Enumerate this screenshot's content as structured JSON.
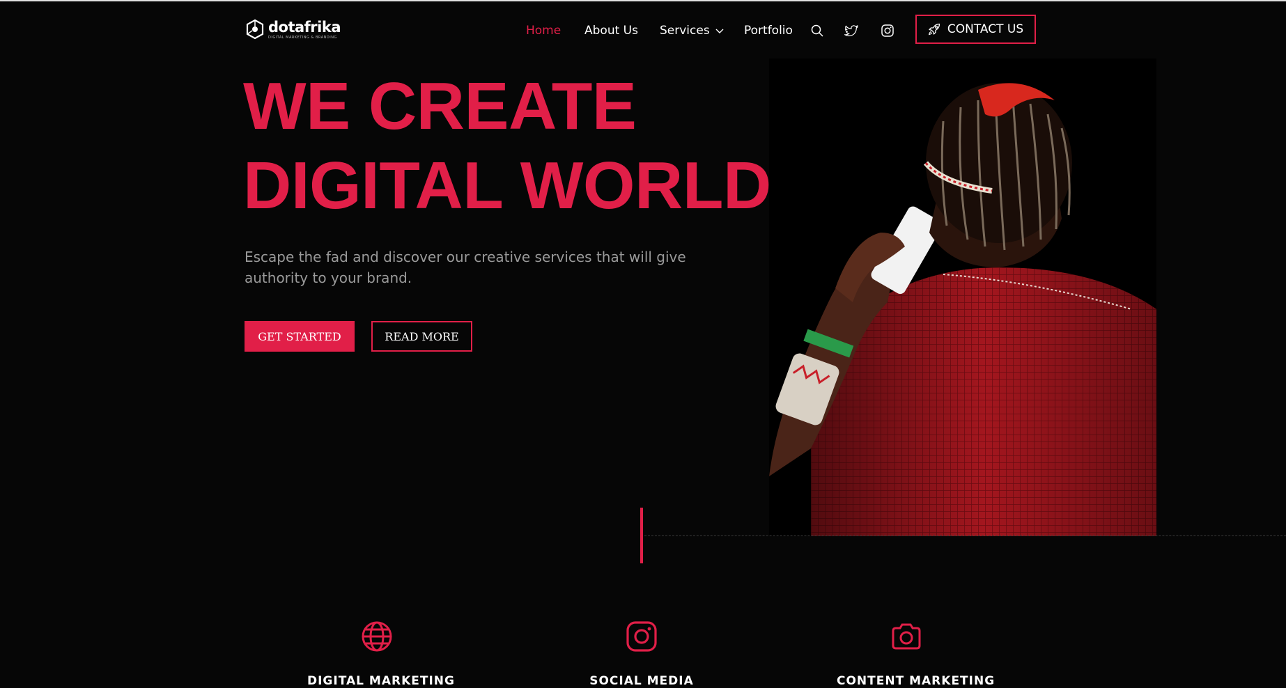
{
  "brand": {
    "name": "dotafrika",
    "tagline": "DIGITAL MARKETING & BRANDING"
  },
  "nav": {
    "items": [
      {
        "label": "Home",
        "active": true
      },
      {
        "label": "About Us",
        "active": false
      },
      {
        "label": "Services",
        "active": false
      },
      {
        "label": "Portfolio",
        "active": false
      }
    ],
    "icons": [
      "search-icon",
      "twitter-icon",
      "instagram-icon"
    ],
    "contact_label": "CONTACT US"
  },
  "hero": {
    "title_line1": "WE CREATE",
    "title_line2": "DIGITAL WORLD",
    "subtitle": "Escape the fad and discover our creative services that will give authority to your brand.",
    "primary_button": "GET STARTED",
    "secondary_button": "READ MORE"
  },
  "services": [
    {
      "label": "DIGITAL MARKETING",
      "icon": "globe-icon"
    },
    {
      "label": "SOCIAL MEDIA",
      "icon": "instagram-icon"
    },
    {
      "label": "CONTENT MARKETING",
      "icon": "camera-icon"
    }
  ],
  "colors": {
    "accent": "#e11f48",
    "background": "#060606",
    "text_muted": "#9a9a9a"
  }
}
